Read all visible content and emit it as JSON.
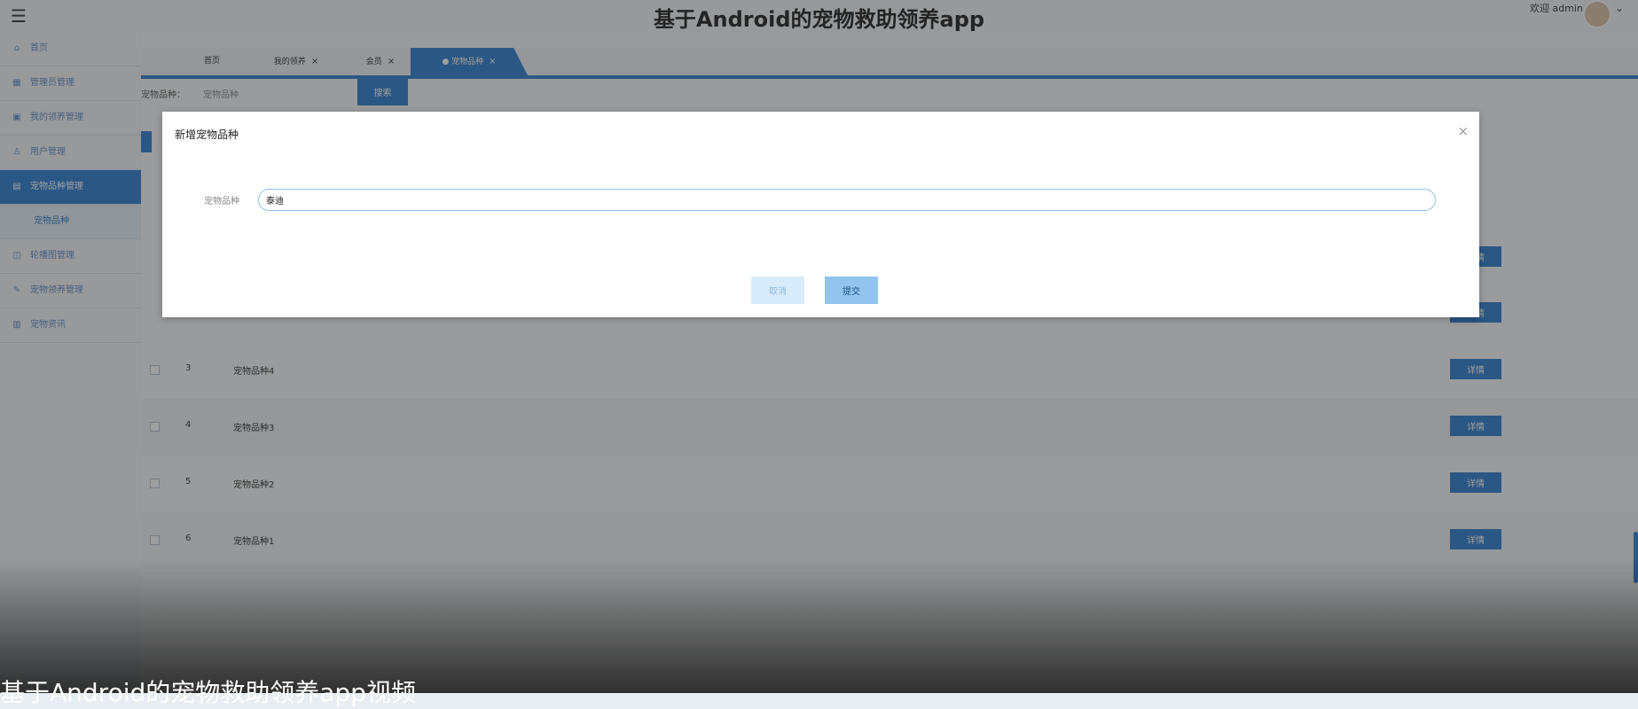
{
  "header": {
    "menu_icon": "hamburger-icon",
    "title": "基于Android的宠物救助领养app",
    "welcome": "欢迎 admin",
    "avatar_caret": "⌄"
  },
  "sidebar": {
    "items": [
      {
        "label": "首页",
        "icon": "home-icon"
      },
      {
        "label": "管理员管理",
        "icon": "grid-icon"
      },
      {
        "label": "我的领养管理",
        "icon": "briefcase-icon"
      },
      {
        "label": "用户管理",
        "icon": "user-icon"
      },
      {
        "label": "宠物品种管理",
        "icon": "table-icon",
        "active": true
      },
      {
        "label": "宠物品种",
        "sub": true
      },
      {
        "label": "轮播图管理",
        "icon": "layout-icon"
      },
      {
        "label": "宠物领养管理",
        "icon": "edit-icon"
      },
      {
        "label": "宠物资讯",
        "icon": "dashboard-icon"
      }
    ]
  },
  "tabs": [
    {
      "label": "首页",
      "close": ""
    },
    {
      "label": "我的领养",
      "close": "×"
    },
    {
      "label": "会员",
      "close": "×"
    },
    {
      "label": "● 宠物品种",
      "close": "×"
    }
  ],
  "filter": {
    "label": "宠物品种：",
    "value": "宠物品种",
    "search_label": "搜索"
  },
  "table": {
    "rows": [
      {
        "index": "3",
        "name": "宠物品种4",
        "action": "详情"
      },
      {
        "index": "4",
        "name": "宠物品种3",
        "action": "详情"
      },
      {
        "index": "5",
        "name": "宠物品种2",
        "action": "详情"
      },
      {
        "index": "6",
        "name": "宠物品种1",
        "action": "详情"
      }
    ],
    "hidden_actions": [
      "详情",
      "详情"
    ]
  },
  "dialog": {
    "title": "新增宠物品种",
    "close": "×",
    "field_label": "宠物品种",
    "field_value": "泰迪",
    "cancel_label": "取消",
    "submit_label": "提交"
  },
  "video": {
    "caption": "基于Android的宠物救助领养app视频"
  },
  "colors": {
    "accent": "#2f7fd1",
    "header_bg": "#f3f6f9",
    "input_border": "#8fc0ea"
  }
}
